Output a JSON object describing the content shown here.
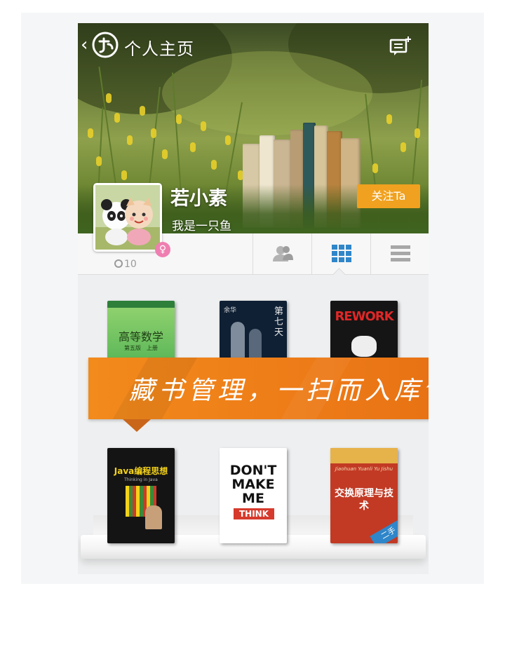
{
  "header": {
    "title": "个人主页",
    "back_icon": "chevron-left-icon",
    "compose_icon": "compose-message-icon"
  },
  "profile": {
    "name": "若小素",
    "bio": "我是一只鱼",
    "follow_label": "关注Ta",
    "gender_symbol": "♀",
    "count": "10"
  },
  "tabs": [
    {
      "icon": "friends-icon",
      "active": false
    },
    {
      "icon": "grid-view-icon",
      "active": true
    },
    {
      "icon": "list-view-icon",
      "active": false
    }
  ],
  "banner": {
    "text": "藏书管理，一扫而入库^^"
  },
  "books": [
    {
      "title": "高等数学",
      "sub": "第五版　上册",
      "color": "#3aa64a"
    },
    {
      "title": "第七天",
      "author": "余华",
      "color": "#0f2034"
    },
    {
      "title": "REWORK",
      "color": "#151515"
    },
    {
      "title": "Java编程思想",
      "sub": "Thinking in Java",
      "color": "#141414"
    },
    {
      "title_lines": [
        "DON'T",
        "MAKE",
        "ME"
      ],
      "tag": "THINK",
      "color": "#ffffff"
    },
    {
      "title": "交换原理与技术",
      "sub": "Jiaohuan Yuanli Yu Jishu",
      "tag": "二手",
      "color": "#c23a24"
    }
  ],
  "colors": {
    "accent": "#f0a11f",
    "banner": "#ee7d18",
    "tab_active": "#2f86c9",
    "tab_inactive": "#9d9d9d"
  }
}
